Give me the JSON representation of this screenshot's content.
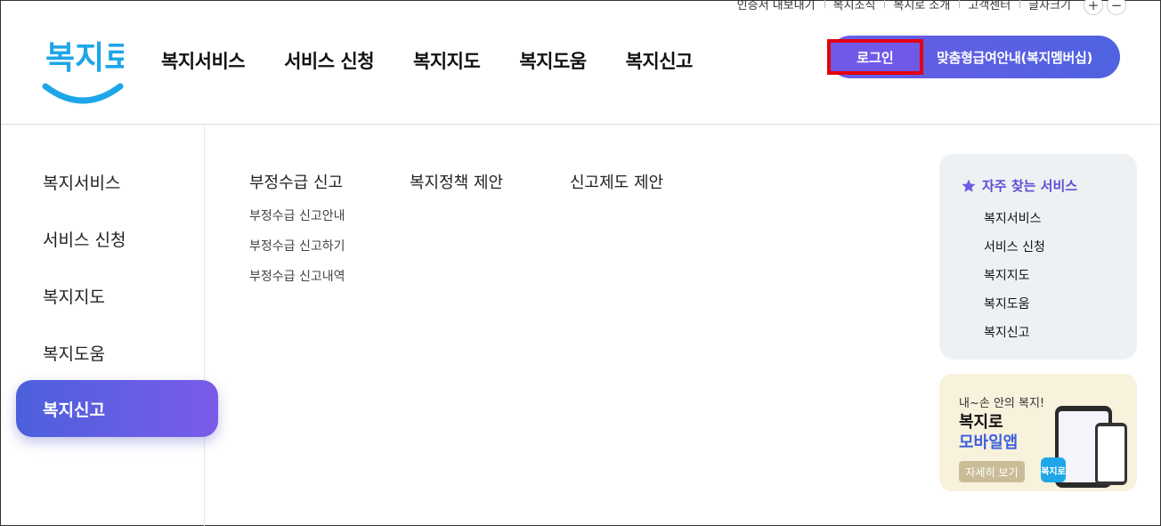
{
  "utility": {
    "items": [
      "인증서 내보내기",
      "복지조직",
      "복지로 소개",
      "고객센터",
      "글자크기"
    ],
    "zoom_in": "+",
    "zoom_out": "−"
  },
  "logo": {
    "text": "복지로"
  },
  "gnb": [
    "복지서비스",
    "서비스 신청",
    "복지지도",
    "복지도움",
    "복지신고"
  ],
  "member": {
    "login": "로그인",
    "membership": "맞춤형급여안내(복지멤버십)"
  },
  "lnb": {
    "items": [
      "복지서비스",
      "서비스 신청",
      "복지지도",
      "복지도움"
    ],
    "active": "복지신고"
  },
  "submenu": [
    {
      "title": "부정수급 신고",
      "items": [
        "부정수급 신고안내",
        "부정수급 신고하기",
        "부정수급 신고내역"
      ]
    },
    {
      "title": "복지정책 제안",
      "items": []
    },
    {
      "title": "신고제도 제안",
      "items": []
    }
  ],
  "favorites": {
    "title": "자주 찾는 서비스",
    "items": [
      "복지서비스",
      "서비스 신청",
      "복지지도",
      "복지도움",
      "복지신고"
    ]
  },
  "app_banner": {
    "line1": "내~손 안의 복지!",
    "line2": "복지로",
    "line3": "모바일앱",
    "button": "자세히 보기"
  },
  "colors": {
    "accent": "#5a4fd6",
    "highlight_border": "#e3000f",
    "brand_blue": "#1ea6e8"
  }
}
